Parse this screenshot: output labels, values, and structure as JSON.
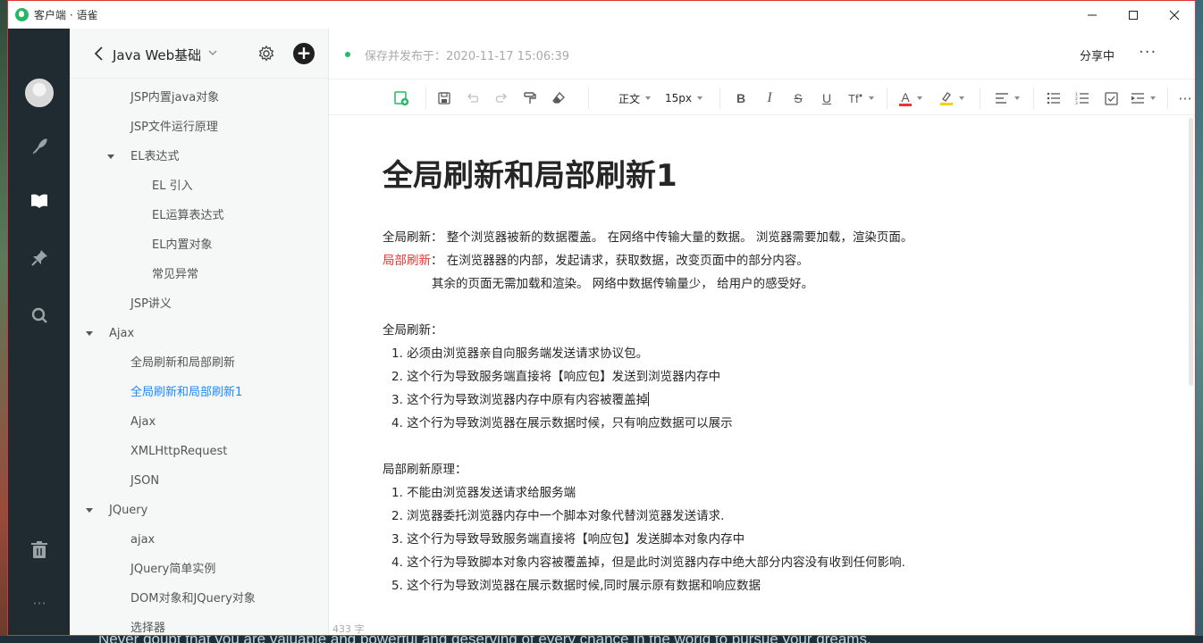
{
  "window": {
    "app_title": "客户端 · 语雀",
    "minimize": "—",
    "maximize": "☐",
    "close": "✕"
  },
  "desktop": {
    "caption": "Never doubt that you are valuable and powerful and deserving of every chance in the world to pursue your dreams."
  },
  "rail": {
    "icons": [
      "avatar",
      "feather-icon",
      "book-icon",
      "pin-icon",
      "search-icon",
      "trash-icon",
      "more-icon"
    ],
    "more": "···"
  },
  "sidebar": {
    "book_title": "Java Web基础",
    "plus": "+",
    "items": [
      {
        "label": "JSP内置java对象",
        "level": 1,
        "expanded": null,
        "active": false
      },
      {
        "label": "JSP文件运行原理",
        "level": 1,
        "expanded": null,
        "active": false
      },
      {
        "label": "EL表达式",
        "level": 1,
        "expanded": true,
        "active": false
      },
      {
        "label": "EL 引入",
        "level": 2,
        "expanded": null,
        "active": false
      },
      {
        "label": "EL运算表达式",
        "level": 2,
        "expanded": null,
        "active": false
      },
      {
        "label": "EL内置对象",
        "level": 2,
        "expanded": null,
        "active": false
      },
      {
        "label": "常见异常",
        "level": 2,
        "expanded": null,
        "active": false
      },
      {
        "label": "JSP讲义",
        "level": 1,
        "expanded": null,
        "active": false
      },
      {
        "label": "Ajax",
        "level": 0,
        "expanded": true,
        "active": false
      },
      {
        "label": "全局刷新和局部刷新",
        "level": 1,
        "expanded": null,
        "active": false
      },
      {
        "label": "全局刷新和局部刷新1",
        "level": 1,
        "expanded": null,
        "active": true
      },
      {
        "label": "Ajax",
        "level": 1,
        "expanded": null,
        "active": false
      },
      {
        "label": "XMLHttpRequest",
        "level": 1,
        "expanded": null,
        "active": false
      },
      {
        "label": "JSON",
        "level": 1,
        "expanded": null,
        "active": false
      },
      {
        "label": "JQuery",
        "level": 0,
        "expanded": true,
        "active": false
      },
      {
        "label": "ajax",
        "level": 1,
        "expanded": null,
        "active": false
      },
      {
        "label": "JQuery简单实例",
        "level": 1,
        "expanded": null,
        "active": false
      },
      {
        "label": "DOM对象和JQuery对象",
        "level": 1,
        "expanded": null,
        "active": false
      },
      {
        "label": "选择器",
        "level": 1,
        "expanded": null,
        "active": false
      }
    ]
  },
  "editor": {
    "save_status": "保存并发布于：2020-11-17 15:06:39",
    "share": "分享中",
    "more": "···",
    "toolbar": {
      "paragraph_style": "正文",
      "font_size": "15px",
      "bold": "B",
      "italic": "I",
      "strike": "S",
      "underline": "U",
      "text_color": "A",
      "overflow": "···"
    },
    "doc": {
      "title": "全局刷新和局部刷新1",
      "line1": " 全局刷新：  整个浏览器被新的数据覆盖。 在网络中传输大量的数据。 浏览器需要加载，渲染页面。",
      "line2_red": "局部刷新",
      "line2_rest": "：  在浏览器器的内部，发起请求，获取数据，改变页面中的部分内容。",
      "line3": "其余的页面无需加载和渲染。 网络中数据传输量少， 给用户的感受好。",
      "global_heading": "全局刷新：",
      "global_items": [
        "1. 必须由浏览器亲自向服务端发送请求协议包。",
        "2. 这个行为导致服务端直接将【响应包】发送到浏览器内存中",
        "3. 这个行为导致浏览器内存中原有内容被覆盖掉",
        "4. 这个行为导致浏览器在展示数据时候，只有响应数据可以展示"
      ],
      "partial_heading": "局部刷新原理：",
      "partial_items": [
        "1. 不能由浏览器发送请求给服务端",
        "2. 浏览器委托浏览器内存中一个脚本对象代替浏览器发送请求.",
        "3. 这个行为导致导致服务端直接将【响应包】发送脚本对象内存中",
        "4. 这个行为导致脚本对象内容被覆盖掉，但是此时浏览器内存中绝大部分内容没有收到任何影响.",
        "5. 这个行为导致浏览器在展示数据时候,同时展示原有数据和响应数据"
      ]
    },
    "word_count": "433 字"
  },
  "colors": {
    "rail_bg": "#1f2b30",
    "active_link": "#1a8cff",
    "brand_green": "#25b864",
    "highlight_red": "#e33333"
  }
}
